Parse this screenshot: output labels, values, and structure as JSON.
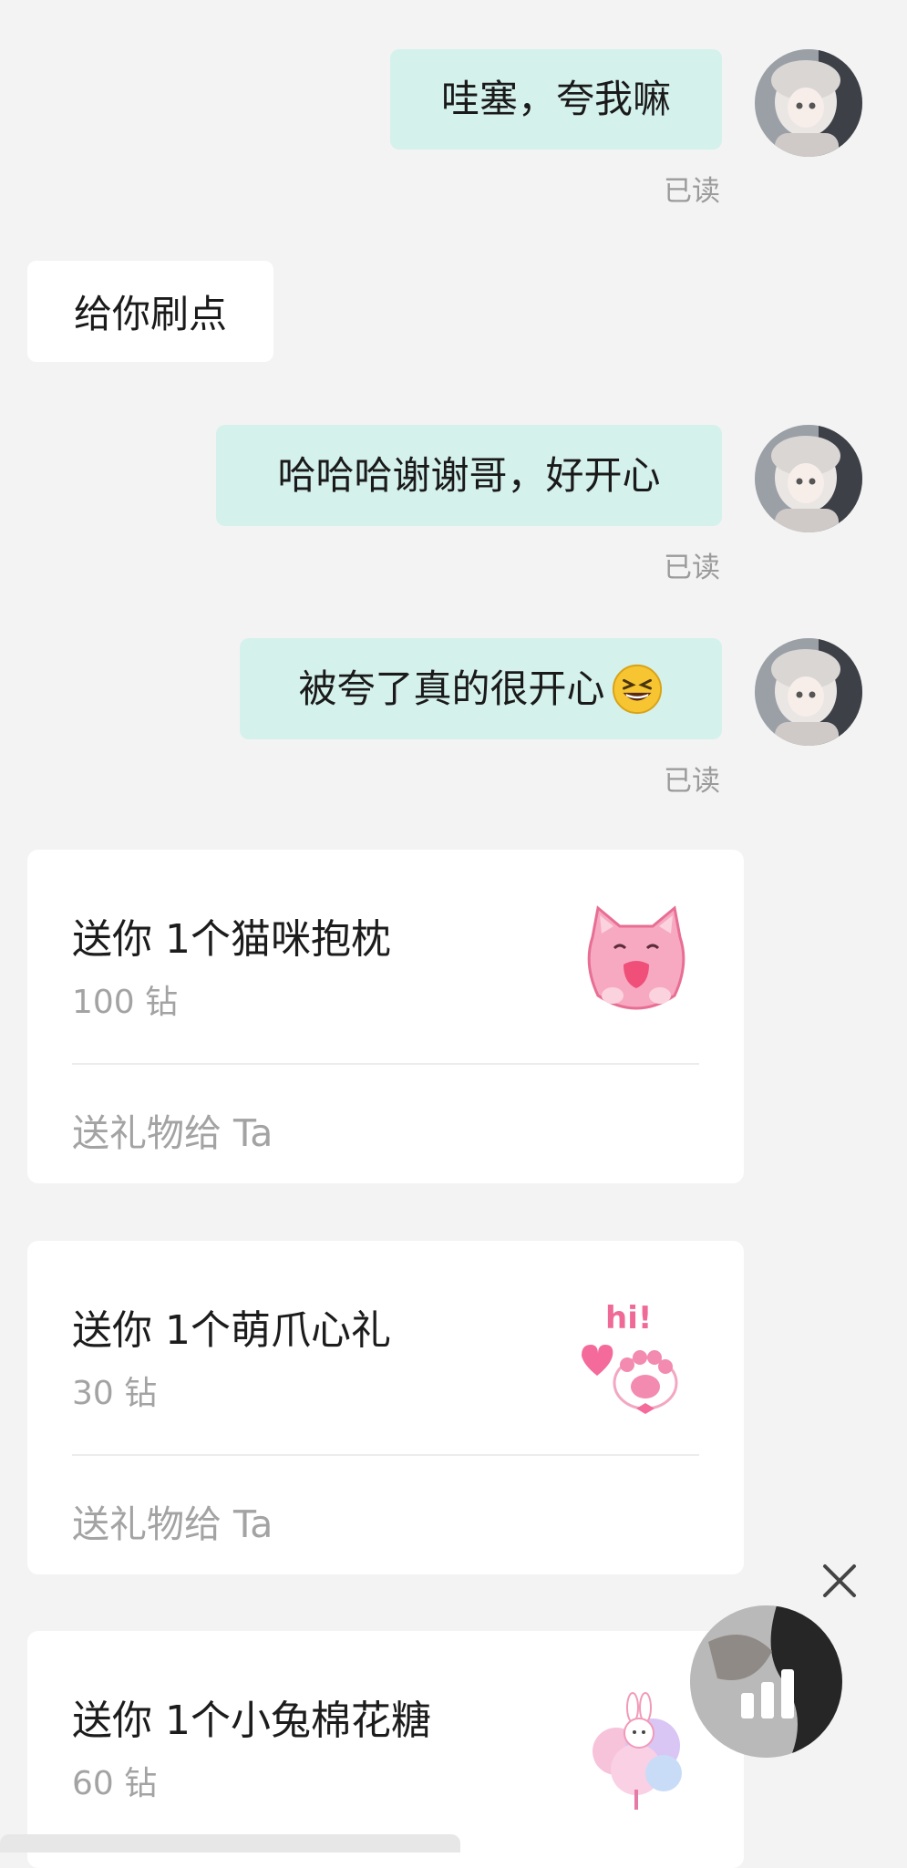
{
  "messages": [
    {
      "side": "out",
      "text": "哇塞，夸我嘛",
      "status": "已读"
    },
    {
      "side": "in",
      "text": "给你刷点"
    },
    {
      "side": "out",
      "text": "哈哈哈谢谢哥，好开心",
      "status": "已读"
    },
    {
      "side": "out",
      "text": "被夸了真的很开心",
      "emoji": "grinning-squinting-face-icon",
      "status": "已读"
    }
  ],
  "gifts": [
    {
      "title": "送你 1个猫咪抱枕",
      "price": "100 钻",
      "action": "送礼物给 Ta",
      "icon": "cat-pillow-icon"
    },
    {
      "title": "送你 1个萌爪心礼",
      "price": "30 钻",
      "action": "送礼物给 Ta",
      "icon": "paw-heart-icon"
    },
    {
      "title": "送你 1个小兔棉花糖",
      "price": "60 钻",
      "icon": "bunny-cotton-candy-icon"
    }
  ],
  "voice_fab": {
    "icon": "voice-bars-icon"
  },
  "close": {
    "icon": "close-icon"
  },
  "colors": {
    "background": "#f3f3f3",
    "outgoing_bubble": "#d5f1ec",
    "incoming_bubble": "#ffffff",
    "muted_text": "#9b9b9b"
  }
}
